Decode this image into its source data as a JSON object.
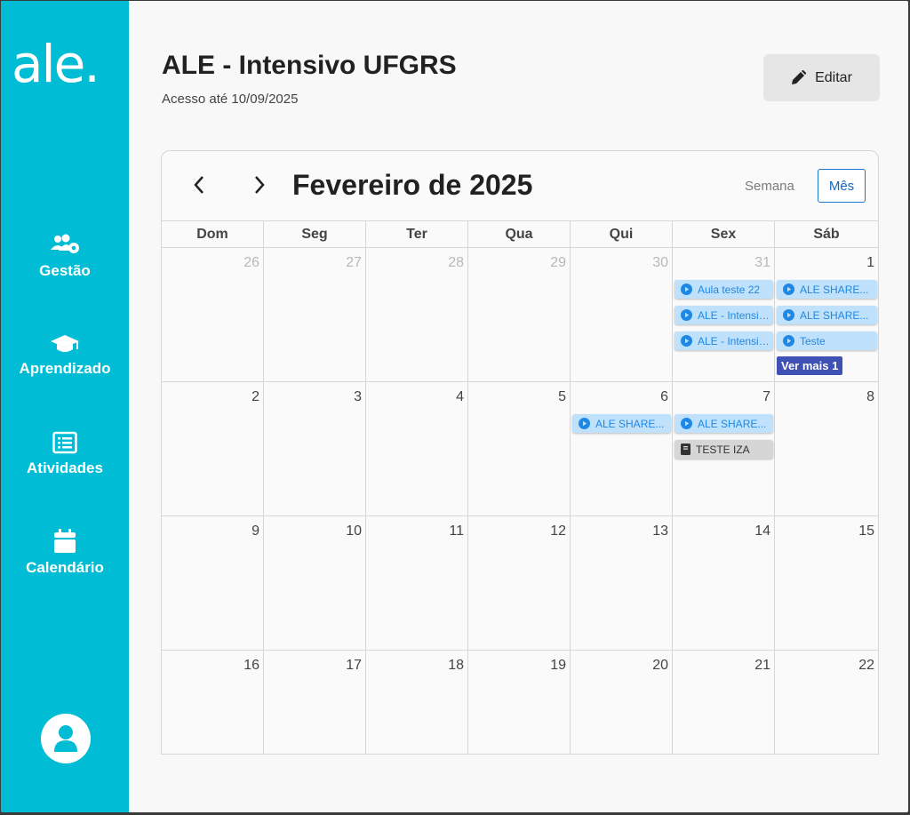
{
  "sidebar": {
    "logo_text": "ale.",
    "items": [
      {
        "label": "Gestão",
        "icon": "users-gear-icon"
      },
      {
        "label": "Aprendizado",
        "icon": "graduation-cap-icon"
      },
      {
        "label": "Atividades",
        "icon": "list-icon"
      },
      {
        "label": "Calendário",
        "icon": "calendar-icon"
      }
    ],
    "avatar_icon": "user-icon",
    "color": "#00bcd4"
  },
  "header": {
    "title": "ALE - Intensivo UFGRS",
    "subtitle": "Acesso até 10/09/2025",
    "edit_label": "Editar"
  },
  "calendar": {
    "month_title": "Fevereiro de 2025",
    "view_week_label": "Semana",
    "view_month_label": "Mês",
    "weekdays": [
      "Dom",
      "Seg",
      "Ter",
      "Qua",
      "Qui",
      "Sex",
      "Sáb"
    ],
    "weeks": [
      [
        {
          "num": "26",
          "other": true
        },
        {
          "num": "27",
          "other": true
        },
        {
          "num": "28",
          "other": true
        },
        {
          "num": "29",
          "other": true
        },
        {
          "num": "30",
          "other": true
        },
        {
          "num": "31",
          "other": true,
          "events": [
            {
              "type": "video",
              "text": "Aula teste 22"
            },
            {
              "type": "video",
              "text": "ALE - Intensivo UFGRS"
            },
            {
              "type": "video",
              "text": "ALE - Intensivo UFGRS"
            }
          ]
        },
        {
          "num": "1",
          "events": [
            {
              "type": "video",
              "text": "ALE SHARE..."
            },
            {
              "type": "video",
              "text": "ALE SHARE..."
            },
            {
              "type": "video",
              "text": "Teste"
            }
          ],
          "more": "Ver mais 1"
        }
      ],
      [
        {
          "num": "2"
        },
        {
          "num": "3"
        },
        {
          "num": "4"
        },
        {
          "num": "5"
        },
        {
          "num": "6",
          "events": [
            {
              "type": "video",
              "text": "ALE SHARE..."
            }
          ]
        },
        {
          "num": "7",
          "events": [
            {
              "type": "video",
              "text": "ALE SHARE..."
            },
            {
              "type": "book",
              "text": "TESTE IZA"
            }
          ]
        },
        {
          "num": "8"
        }
      ],
      [
        {
          "num": "9"
        },
        {
          "num": "10"
        },
        {
          "num": "11"
        },
        {
          "num": "12"
        },
        {
          "num": "13"
        },
        {
          "num": "14"
        },
        {
          "num": "15"
        }
      ],
      [
        {
          "num": "16"
        },
        {
          "num": "17"
        },
        {
          "num": "18"
        },
        {
          "num": "19"
        },
        {
          "num": "20"
        },
        {
          "num": "21"
        },
        {
          "num": "22"
        }
      ]
    ],
    "colors": {
      "video_bg": "#bfe1fb",
      "video_text": "#1e88e5",
      "book_bg": "#d6d6d6",
      "more_bg": "#3f51b5"
    }
  }
}
